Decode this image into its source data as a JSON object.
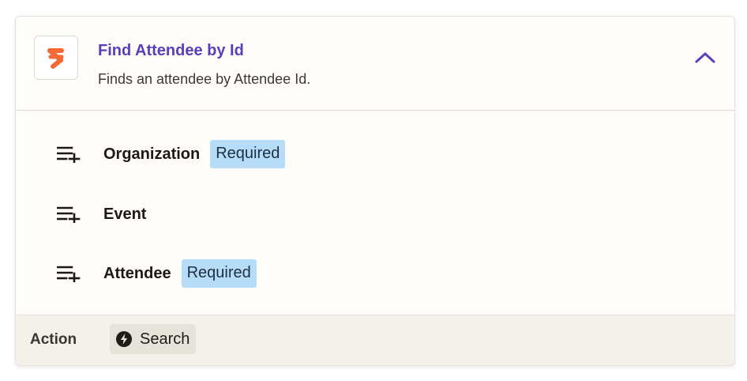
{
  "step": {
    "app_icon": "teamup-logo-icon",
    "title": "Find Attendee by Id",
    "description": "Finds an attendee by Attendee Id.",
    "collapse_icon": "chevron-up-icon"
  },
  "fields": [
    {
      "label": "Organization",
      "badge": "Required",
      "icon": "playlist-add-icon"
    },
    {
      "label": "Event",
      "badge": "",
      "icon": "playlist-add-icon"
    },
    {
      "label": "Attendee",
      "badge": "Required",
      "icon": "playlist-add-icon"
    }
  ],
  "footer": {
    "label": "Action",
    "chip_icon": "bolt-icon",
    "chip_label": "Search"
  },
  "colors": {
    "title": "#5a3fb8",
    "badge_bg": "#b6dcf7",
    "logo": "#f46a35",
    "footer_bg": "#f3f1ea"
  }
}
